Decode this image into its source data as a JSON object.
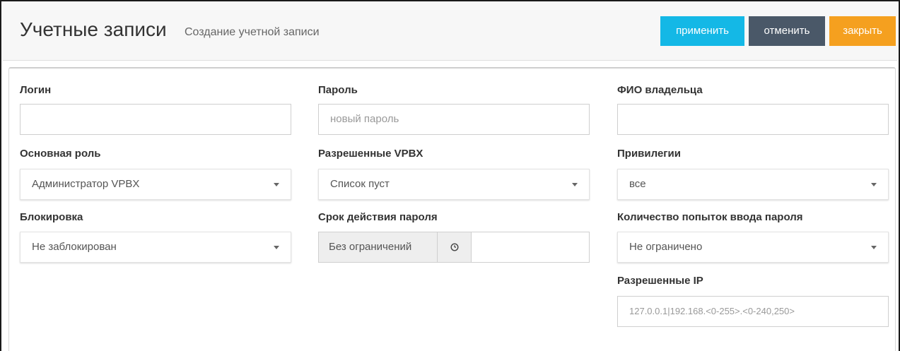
{
  "header": {
    "title": "Учетные записи",
    "subtitle": "Создание учетной записи",
    "apply_label": "применить",
    "cancel_label": "отменить",
    "close_label": "закрыть"
  },
  "colors": {
    "apply": "#14b8e6",
    "cancel": "#4a5868",
    "close": "#f5a01f"
  },
  "form": {
    "login": {
      "label": "Логин",
      "value": "",
      "placeholder": ""
    },
    "password": {
      "label": "Пароль",
      "value": "",
      "placeholder": "новый пароль"
    },
    "owner": {
      "label": "ФИО владельца",
      "value": "",
      "placeholder": ""
    },
    "role": {
      "label": "Основная роль",
      "selected": "Администратор VPBX"
    },
    "vpbx": {
      "label": "Разрешенные VPBX",
      "selected": "Список пуст"
    },
    "privileges": {
      "label": "Привилегии",
      "selected": "все"
    },
    "lock": {
      "label": "Блокировка",
      "selected": "Не заблокирован"
    },
    "password_expiry": {
      "label": "Срок действия пароля",
      "addon_text": "Без ограничений",
      "icon": "clock-icon",
      "value": ""
    },
    "attempts": {
      "label": "Количество попыток ввода пароля",
      "selected": "Не ограничено"
    },
    "allowed_ip": {
      "label": "Разрешенные IP",
      "placeholder": "127.0.0.1|192.168.<0-255>.<0-240,250>"
    }
  }
}
